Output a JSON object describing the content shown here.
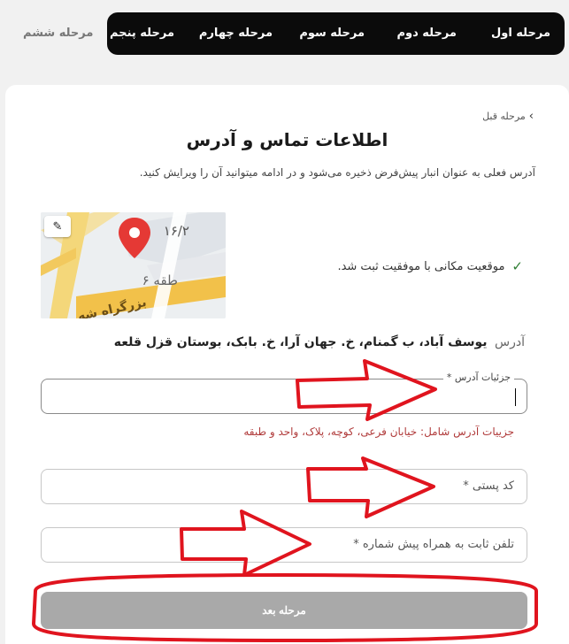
{
  "steps": {
    "step1": "مرحله اول",
    "step2": "مرحله دوم",
    "step3": "مرحله سوم",
    "step4": "مرحله چهارم",
    "step5": "مرحله پنجم",
    "step6": "مرحله ششم"
  },
  "card": {
    "back_label": "مرحله قبل",
    "title": "اطلاعات تماس و آدرس",
    "subtitle": "آدرس فعلی به عنوان انبار پیش‌فرض ذخیره می‌شود و در ادامه میتوانید آن را ویرایش کنید.",
    "location_success": "موقعیت مکانی با موفقیت ثبت شد.",
    "address_label": "آدرس",
    "address_value": "یوسف آباد، ب گمنام، خ. جهان آرا، خ. بابک، بوستان قزل قلعه",
    "details_label": "جزئیات آدرس *",
    "details_value": "",
    "details_hint": "جزییات آدرس شامل: خیابان فرعی، کوچه، پلاک، واحد و طبقه",
    "postal_placeholder": "کد پستی *",
    "phone_placeholder": "تلفن ثابت به همراه پیش شماره *",
    "next_label": "مرحله بعد"
  },
  "map": {
    "text_1": "۱۶/۲",
    "text_2": "طقه ۶",
    "text_3": "بزرگراه شه"
  },
  "colors": {
    "steps_bg": "#0b0b0b",
    "success": "#2e7d32",
    "hint": "#b03a3a",
    "button_disabled": "#a9a9a9",
    "annotation": "#e0141e"
  }
}
